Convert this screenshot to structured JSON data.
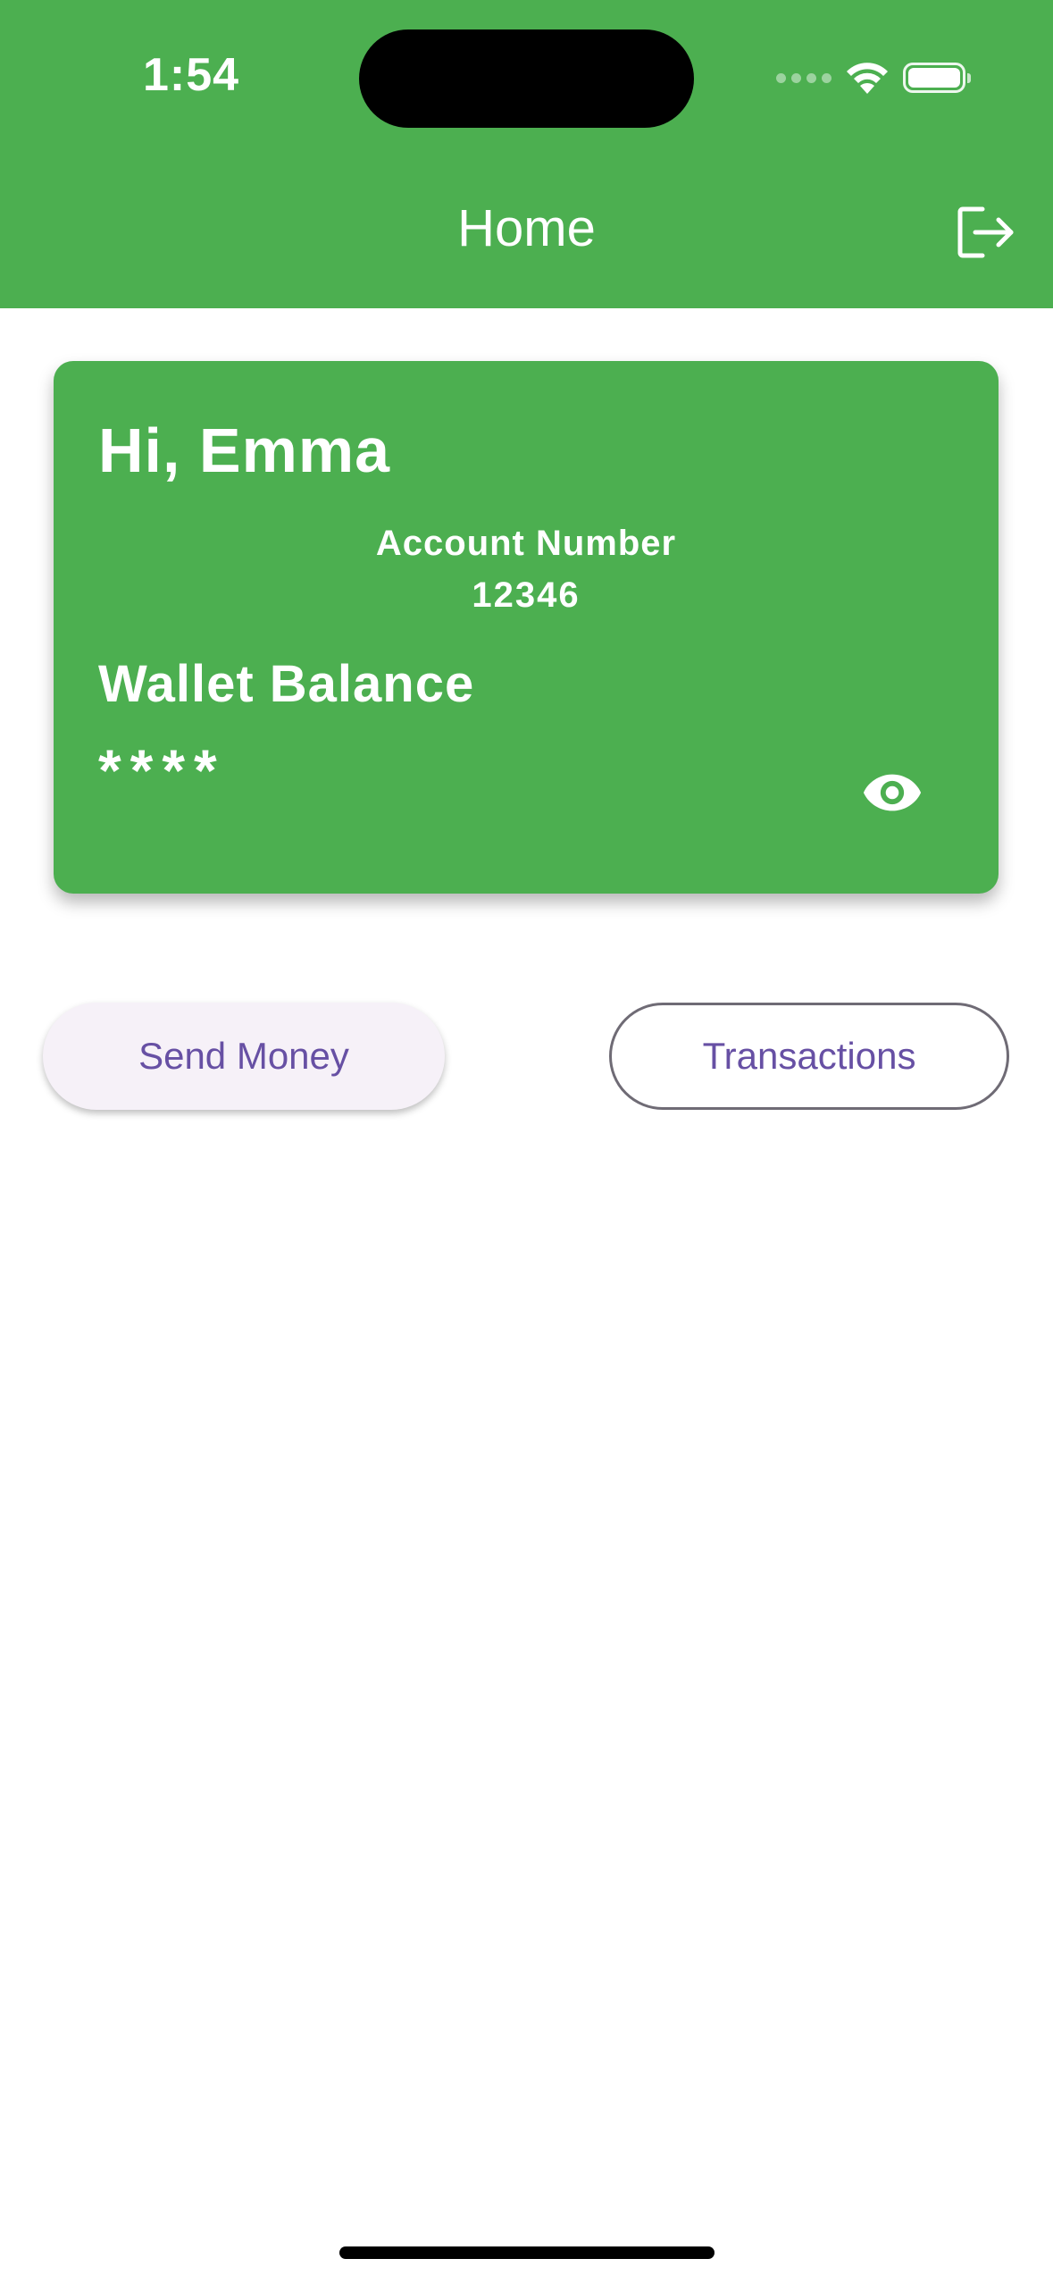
{
  "status_bar": {
    "time": "1:54"
  },
  "header": {
    "title": "Home",
    "logout_icon": "logout-icon"
  },
  "wallet_card": {
    "greeting": "Hi, Emma",
    "account_label": "Account Number",
    "account_number": "12346",
    "balance_label": "Wallet Balance",
    "balance_value": "****",
    "toggle_icon": "eye-icon"
  },
  "actions": {
    "send_money_label": "Send Money",
    "transactions_label": "Transactions"
  },
  "colors": {
    "primary_green": "#4caf50",
    "button_text": "#6750a4",
    "send_button_bg": "#f6f1f8",
    "outline": "#6f6b75"
  }
}
